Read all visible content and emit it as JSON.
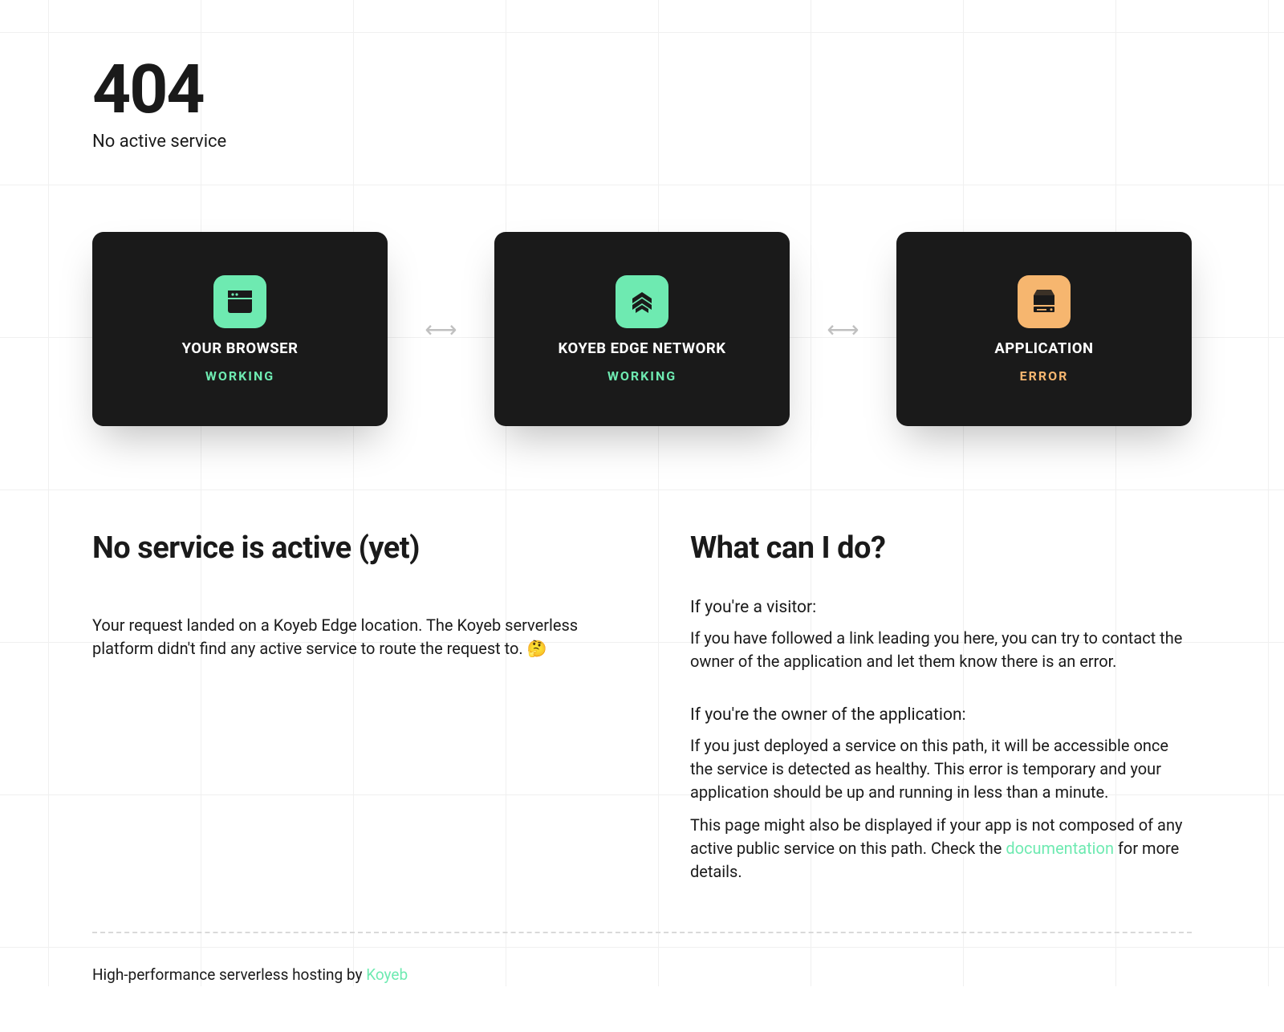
{
  "header": {
    "code": "404",
    "subtitle": "No active service"
  },
  "cards": {
    "browser": {
      "title": "YOUR BROWSER",
      "status": "WORKING"
    },
    "edge": {
      "title": "KOYEB EDGE NETWORK",
      "status": "WORKING"
    },
    "app": {
      "title": "APPLICATION",
      "status": "ERROR"
    }
  },
  "left": {
    "heading": "No service is active (yet)",
    "body": "Your request landed on a Koyeb Edge location. The Koyeb serverless platform didn't find any active service to route the request to. 🤔"
  },
  "right": {
    "heading": "What can I do?",
    "visitor_heading": "If you're a visitor:",
    "visitor_body": "If you have followed a link leading you here, you can try to contact the owner of the application and let them know there is an error.",
    "owner_heading": "If you're the owner of the application:",
    "owner_body1": "If you just deployed a service on this path, it will be accessible once the service is detected as healthy. This error is temporary and your application should be up and running in less than a minute.",
    "owner_body2_pre": "This page might also be displayed if your app is not composed of any active public service on this path. Check the ",
    "owner_body2_link": "documentation",
    "owner_body2_post": " for more details."
  },
  "footer": {
    "text": "High-performance serverless hosting by ",
    "link": "Koyeb"
  },
  "colors": {
    "green": "#6eeab1",
    "orange": "#f6b66f",
    "dark": "#1a1a1a"
  }
}
